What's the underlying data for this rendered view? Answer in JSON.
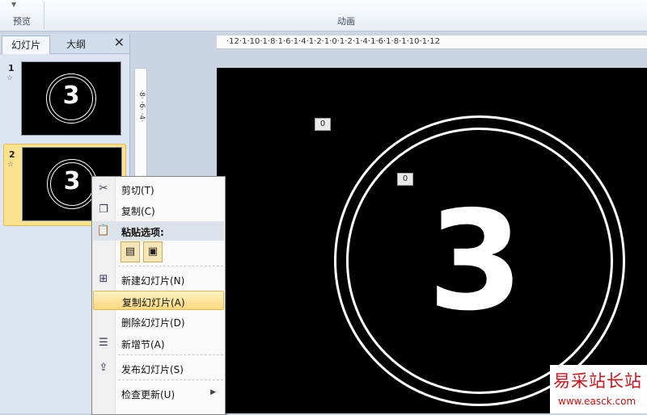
{
  "ribbon": {
    "groups": [
      {
        "label": "预览"
      },
      {
        "label": "动画"
      }
    ]
  },
  "panel": {
    "tabs": [
      {
        "label": "幻灯片"
      },
      {
        "label": "大纲"
      }
    ],
    "close": "✕",
    "slides": [
      {
        "number": "1",
        "content": "3",
        "selected": false
      },
      {
        "number": "2",
        "content": "3",
        "selected": true
      }
    ]
  },
  "ruler": {
    "horizontal": "·12·1·10·1·8·1·6·1·4·1·2·1·0·1·2·1·4·1·6·1·8·1·10·1·12",
    "vertical": "·8· ·6· ·4·"
  },
  "slide": {
    "big_text": "3",
    "anim_tags": [
      "0",
      "0"
    ]
  },
  "context_menu": {
    "items": [
      {
        "label": "剪切(T)",
        "icon": "scissors-icon"
      },
      {
        "label": "复制(C)",
        "icon": "copy-icon"
      },
      {
        "label": "粘贴选项:",
        "icon": "paste-icon",
        "header": true
      },
      {
        "label": "新建幻灯片(N)",
        "icon": "new-slide-icon"
      },
      {
        "label": "复制幻灯片(A)",
        "icon": "",
        "highlighted": true
      },
      {
        "label": "删除幻灯片(D)",
        "icon": ""
      },
      {
        "label": "新增节(A)",
        "icon": "new-section-icon"
      },
      {
        "label": "发布幻灯片(S)",
        "icon": "publish-icon"
      },
      {
        "label": "检查更新(U)",
        "icon": "",
        "submenu": true
      }
    ]
  },
  "watermark": {
    "line1": "易采站长站",
    "line2": "www.easck.com"
  },
  "colors": {
    "highlight": "#fbd97d",
    "slide_bg": "#000000",
    "watermark_red": "#d0141b"
  }
}
